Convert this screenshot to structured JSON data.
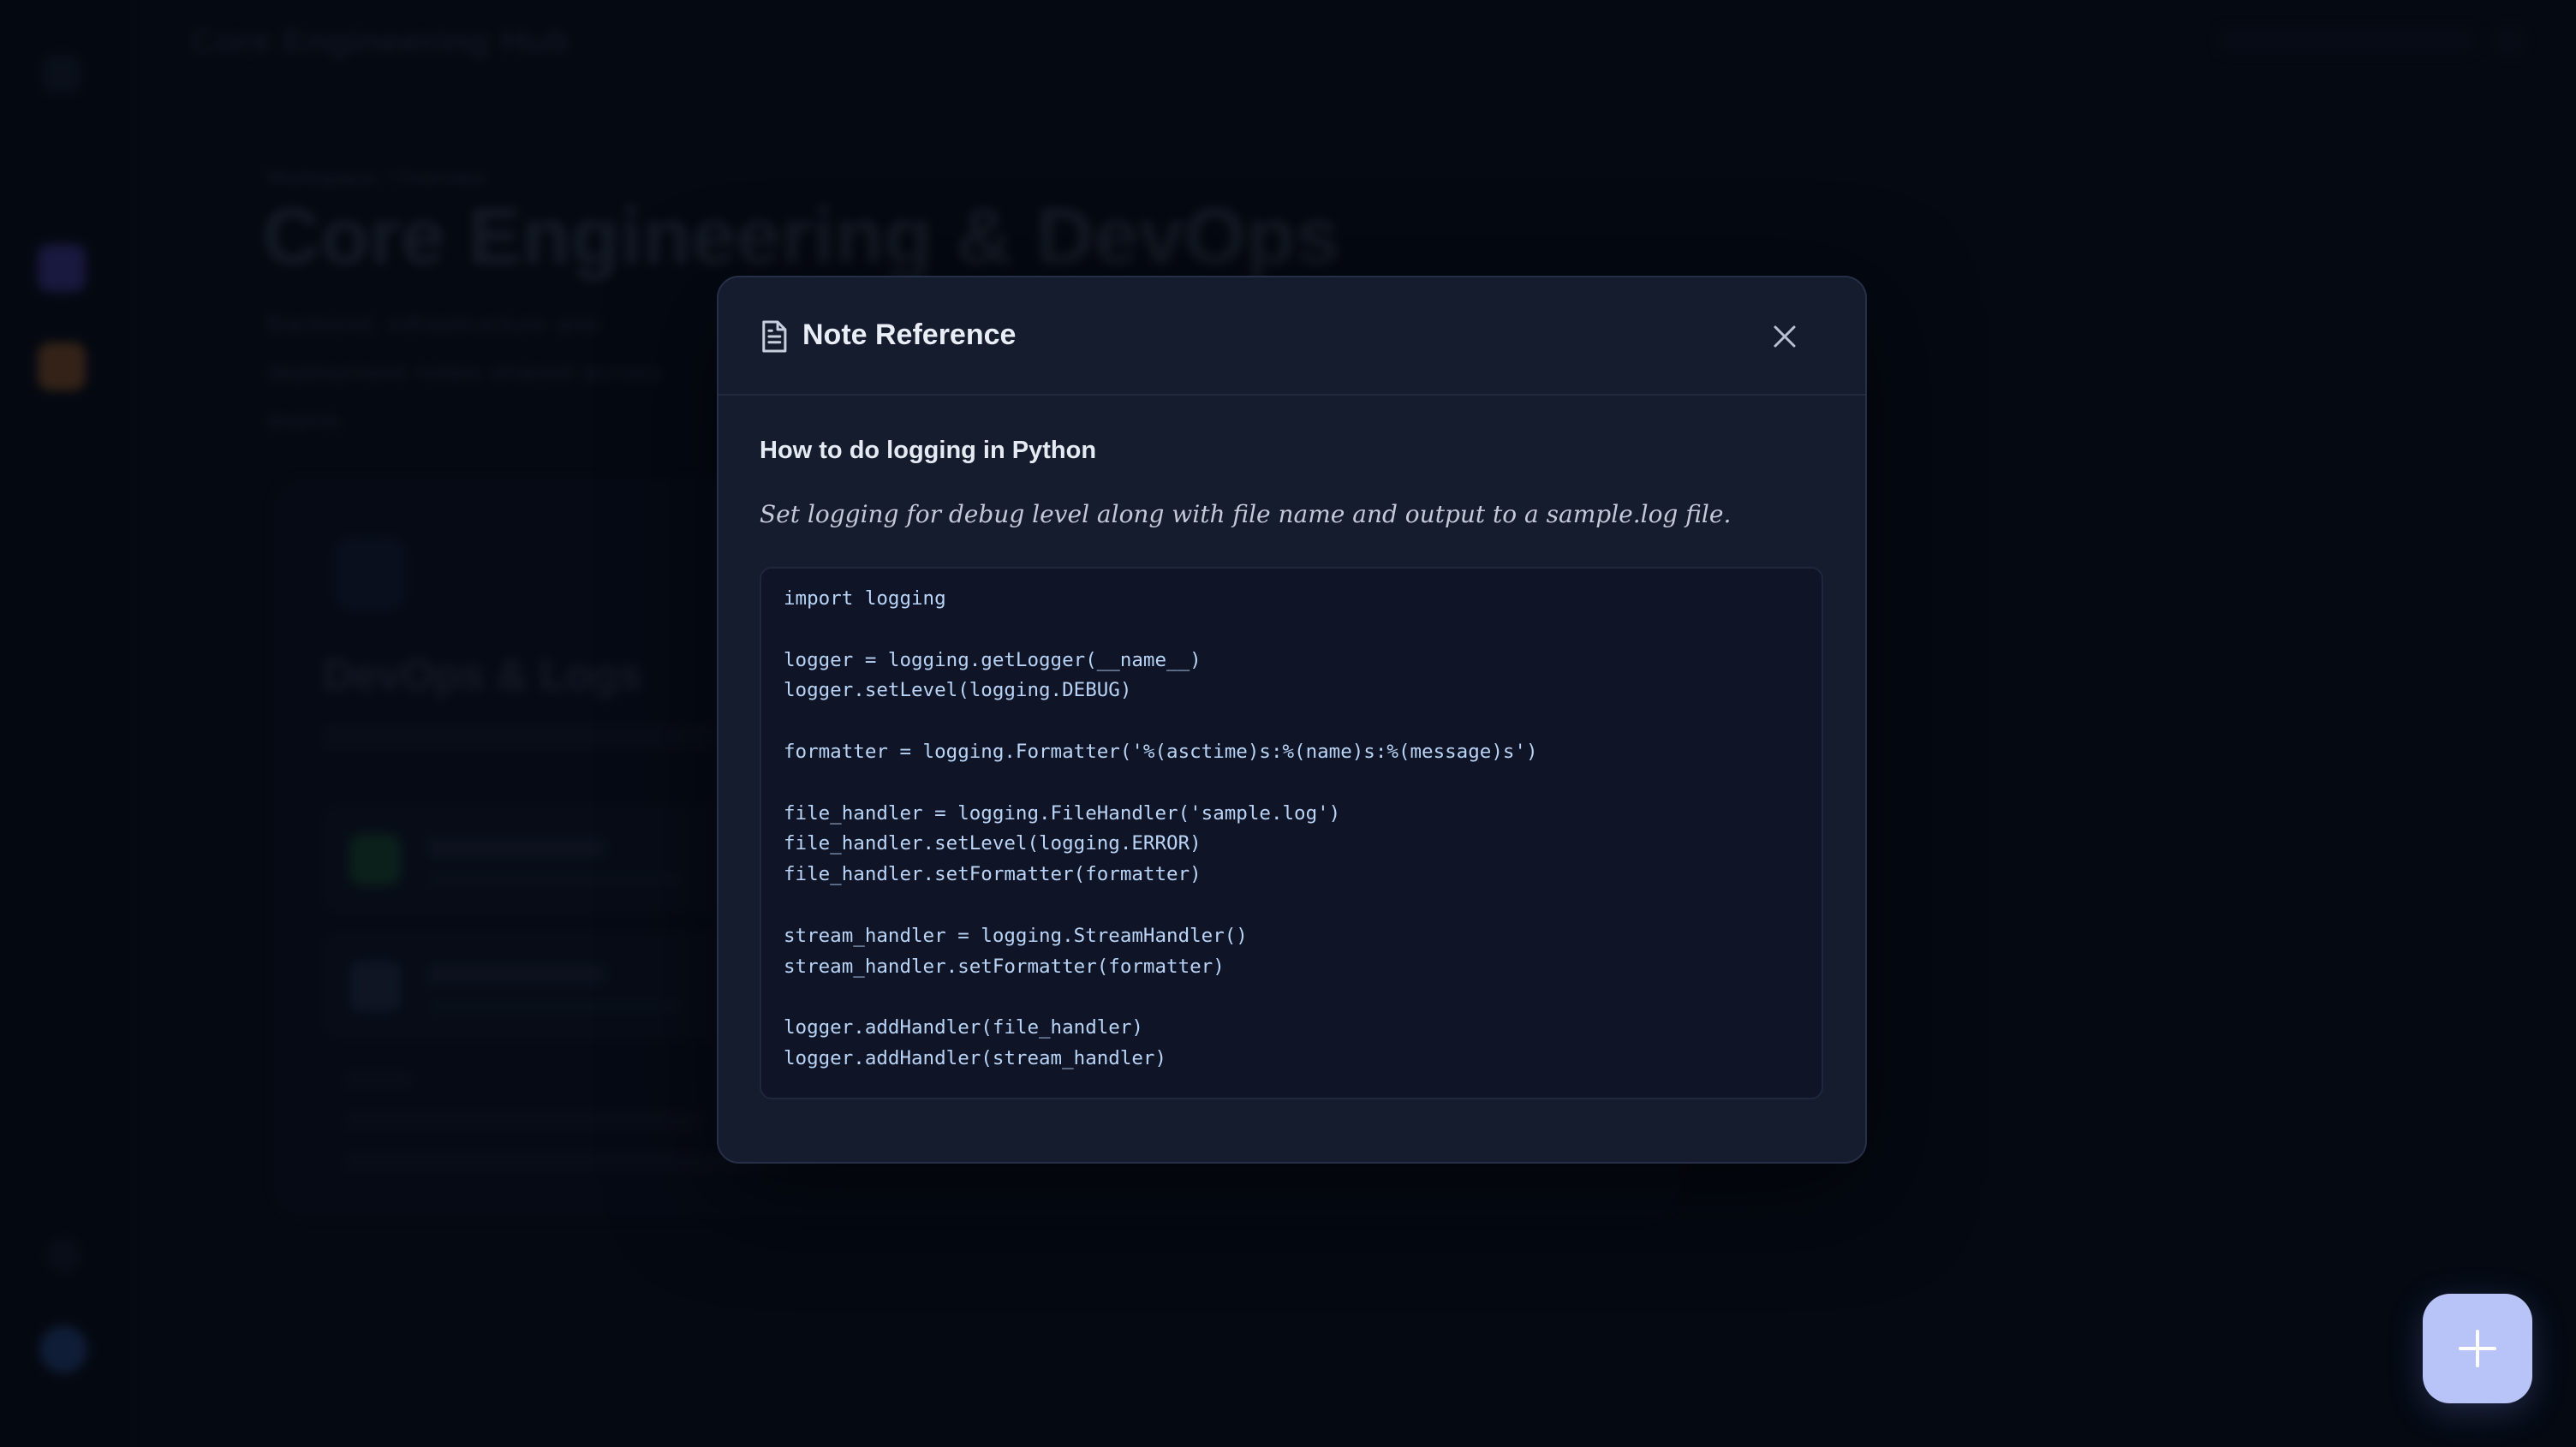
{
  "background": {
    "app_title": "Core Engineering Hub",
    "breadcrumb": "Workspace / Overview",
    "page_title": "Core Engineering & DevOps",
    "page_description": "Backend, infrastructure and deployment notes shared across teams.",
    "card_title": "DevOps & Logs"
  },
  "modal": {
    "icon": "document-icon",
    "title": "Note Reference",
    "close_icon": "close-icon",
    "note_title": "How to do logging in Python",
    "note_description": "Set logging for debug level along with file name and output to a sample.log file.",
    "code_lines": [
      "import logging",
      "",
      "logger = logging.getLogger(__name__)",
      "logger.setLevel(logging.DEBUG)",
      "",
      "formatter = logging.Formatter('%(asctime)s:%(name)s:%(message)s')",
      "",
      "file_handler = logging.FileHandler('sample.log')",
      "file_handler.setLevel(logging.ERROR)",
      "file_handler.setFormatter(formatter)",
      "",
      "stream_handler = logging.StreamHandler()",
      "stream_handler.setFormatter(formatter)",
      "",
      "logger.addHandler(file_handler)",
      "logger.addHandler(stream_handler)"
    ]
  },
  "fab": {
    "icon": "plus-icon"
  },
  "colors": {
    "background": "#070b16",
    "modal_bg": "#151c2e",
    "code_bg": "#0f1526",
    "code_text": "#b9d4f6",
    "fab_bg": "#b8c4f7"
  }
}
